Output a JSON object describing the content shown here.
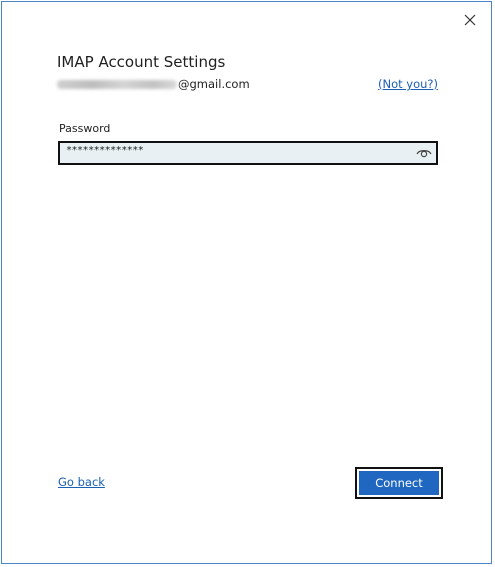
{
  "dialog": {
    "title": "IMAP Account Settings",
    "close_icon": "close-icon",
    "account": {
      "email_suffix": "@gmail.com",
      "not_you_label": "(Not you?)"
    },
    "password": {
      "label": "Password",
      "value": "**************",
      "reveal_icon": "eye-icon"
    },
    "footer": {
      "go_back_label": "Go back",
      "connect_label": "Connect"
    }
  },
  "colors": {
    "accent": "#1f67c0",
    "link": "#1a5fb4",
    "border": "#4a86c5",
    "field_bg": "#e9f0f4"
  }
}
